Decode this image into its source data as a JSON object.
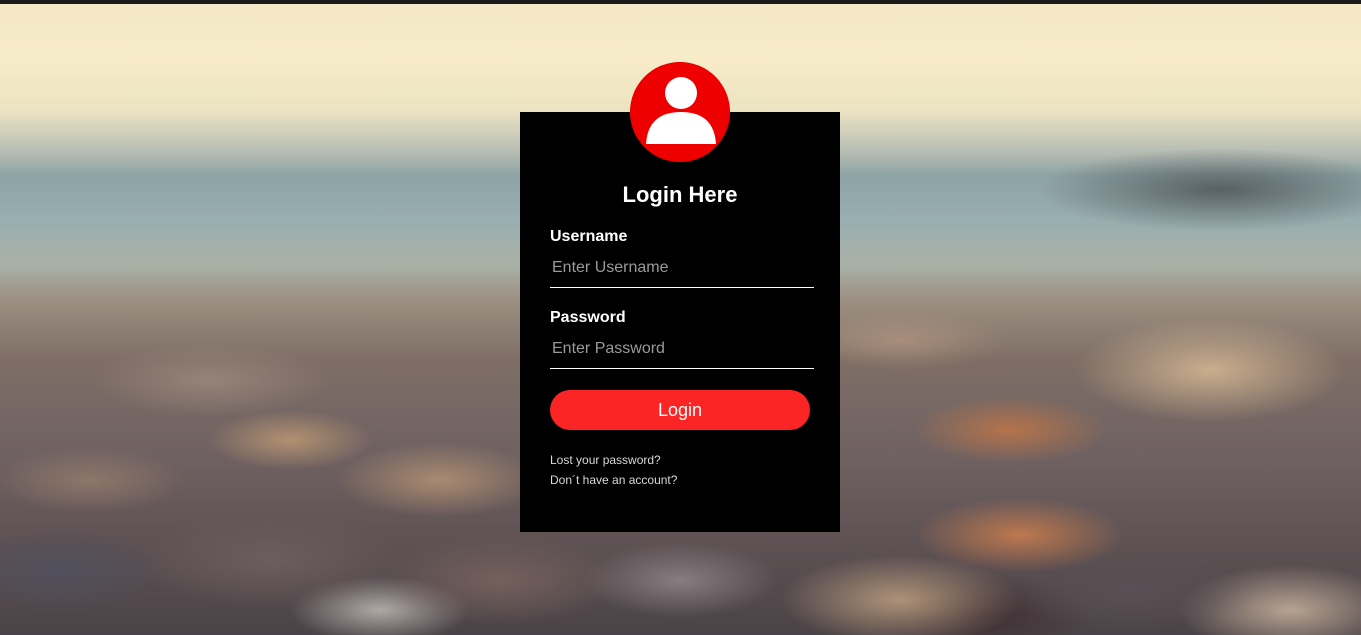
{
  "login": {
    "title": "Login Here",
    "username_label": "Username",
    "username_placeholder": "Enter Username",
    "password_label": "Password",
    "password_placeholder": "Enter Password",
    "button_label": "Login",
    "lost_password_link": "Lost your password?",
    "signup_link": "Don´t have an account?"
  },
  "icons": {
    "avatar": "user-avatar-icon"
  },
  "colors": {
    "accent": "#fb2525",
    "avatar_bg": "#ee0000",
    "box_bg": "#000000",
    "text": "#ffffff"
  }
}
